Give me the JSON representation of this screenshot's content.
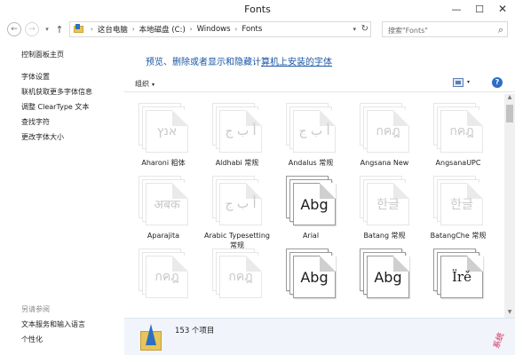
{
  "window": {
    "title": "Fonts",
    "minimize": "—",
    "maximize": "☐",
    "close": "✕"
  },
  "nav": {
    "back": "←",
    "forward": "→",
    "history": "▾",
    "up": "↑",
    "breadcrumb": [
      "这台电脑",
      "本地磁盘 (C:)",
      "Windows",
      "Fonts"
    ],
    "separator": "›",
    "address_dropdown": "▾",
    "refresh": "↻",
    "search_placeholder": "搜索\"Fonts\"",
    "search_icon": "⌕"
  },
  "sidebar": {
    "home": "控制面板主页",
    "links": [
      "字体设置",
      "联机获取更多字体信息",
      "调整 ClearType 文本",
      "查找字符",
      "更改字体大小"
    ],
    "see_also_heading": "另请参阅",
    "see_also": [
      "文本服务和输入语言",
      "个性化"
    ]
  },
  "main": {
    "banner_pre": "预览、删除或者显示和隐藏计",
    "banner_link": "算机上安装的字体",
    "organize": "组织",
    "organize_arrow": "▾",
    "view_dropdown": "▾",
    "help": "?"
  },
  "fonts": [
    {
      "label": "Aharoni 粗体",
      "sample": "אנץ",
      "style": "faded"
    },
    {
      "label": "Aldhabi 常规",
      "sample": "أ ب ج",
      "style": "faded"
    },
    {
      "label": "Andalus 常规",
      "sample": "أ ب ج",
      "style": "faded"
    },
    {
      "label": "Angsana New",
      "sample": "กคฎ",
      "style": "faded"
    },
    {
      "label": "AngsanaUPC",
      "sample": "กคฎ",
      "style": "faded"
    },
    {
      "label": "Aparajita",
      "sample": "अबक",
      "style": "faded"
    },
    {
      "label": "Arabic Typesetting 常规",
      "sample": "أ ب ج",
      "style": "faded"
    },
    {
      "label": "Arial",
      "sample": "Abg",
      "style": "dark"
    },
    {
      "label": "Batang 常规",
      "sample": "한글",
      "style": "faded"
    },
    {
      "label": "BatangChe 常规",
      "sample": "한글",
      "style": "faded"
    },
    {
      "label": "",
      "sample": "กคฎ",
      "style": "faded"
    },
    {
      "label": "",
      "sample": "กคฎ",
      "style": "faded"
    },
    {
      "label": "",
      "sample": "Abg",
      "style": "dark"
    },
    {
      "label": "",
      "sample": "Abg",
      "style": "dark"
    },
    {
      "label": "",
      "sample": "Ïrě",
      "style": "dark-serif"
    }
  ],
  "details": {
    "count": "153 个项目"
  },
  "watermark": "系统"
}
